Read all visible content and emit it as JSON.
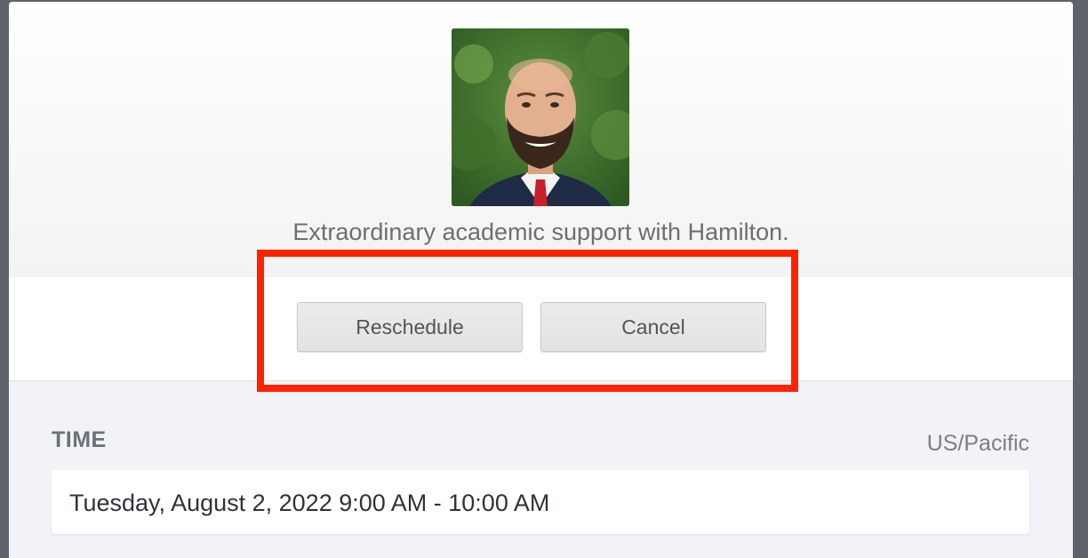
{
  "host": {
    "avatar_alt": "Host photo",
    "tagline": "Extraordinary academic support with Hamilton."
  },
  "actions": {
    "reschedule_label": "Reschedule",
    "cancel_label": "Cancel"
  },
  "time_section": {
    "label": "TIME",
    "timezone": "US/Pacific",
    "value": "Tuesday, August 2, 2022 9:00 AM - 10:00 AM"
  },
  "colors": {
    "highlight": "#ff2200",
    "button_bg": "#e6e6e6",
    "details_bg": "#f1f3f6"
  }
}
